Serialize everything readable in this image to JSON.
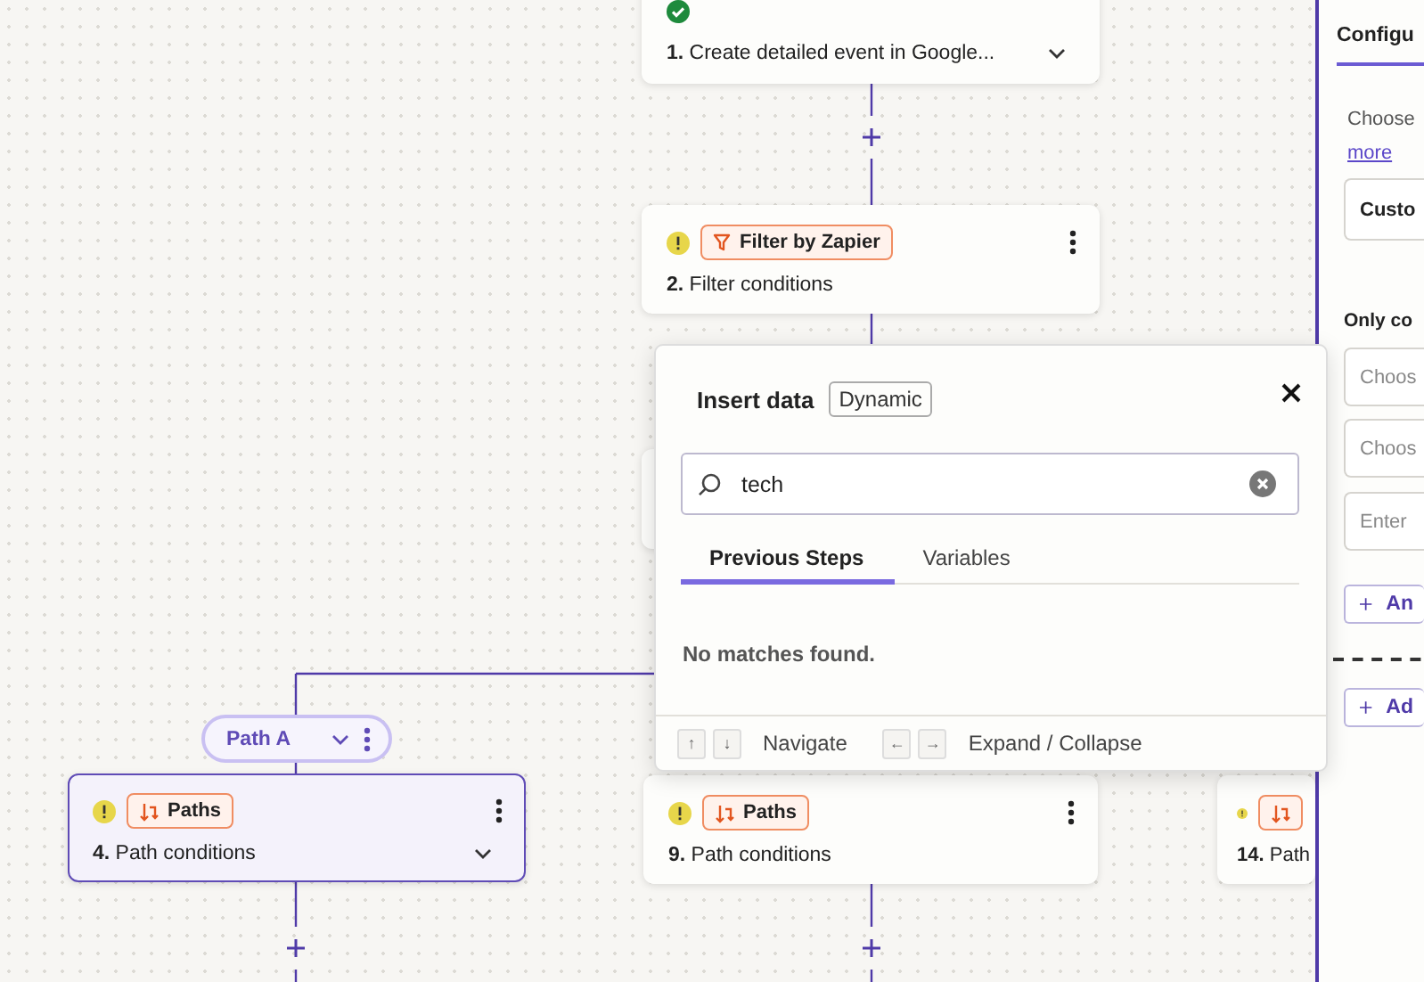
{
  "steps": [
    {
      "number": "1.",
      "title": "Create detailed event in Google...",
      "kind": "done",
      "selected": false,
      "expandable": true,
      "menu": false
    },
    {
      "number": "2.",
      "title": "Filter conditions",
      "kind": "warning",
      "badge": {
        "kind": "filter",
        "label": "Filter by Zapier"
      },
      "selected": false,
      "expandable": false,
      "menu": true
    },
    {
      "number": "4.",
      "title": "Path conditions",
      "kind": "warning",
      "badge": {
        "kind": "paths",
        "label": "Paths"
      },
      "selected": true,
      "expandable": true,
      "menu": true
    },
    {
      "number": "9.",
      "title": "Path conditions",
      "kind": "warning",
      "badge": {
        "kind": "paths",
        "label": "Paths"
      },
      "selected": false,
      "expandable": false,
      "menu": true
    },
    {
      "number": "14.",
      "title": "Path",
      "kind": "warning",
      "badge": {
        "kind": "paths"
      },
      "selected": false,
      "expandable": false,
      "menu": false
    }
  ],
  "path_pill": {
    "label": "Path A"
  },
  "insert_data": {
    "title": "Insert data",
    "tag": "Dynamic",
    "search": {
      "value": "tech"
    },
    "tabs": [
      {
        "label": "Previous Steps",
        "selected": true
      },
      {
        "label": "Variables",
        "selected": false
      }
    ],
    "empty_message": "No matches found.",
    "shortcuts": [
      {
        "keys": [
          "↑",
          "↓"
        ],
        "label": "Navigate"
      },
      {
        "keys": [
          "←",
          "→"
        ],
        "label": "Expand / Collapse"
      }
    ]
  },
  "side_panel": {
    "tab": "Configu",
    "intro": "Choose",
    "link": "more",
    "select_value": "Custo",
    "section_title": "Only co",
    "fields": [
      {
        "placeholder": "Choos"
      },
      {
        "placeholder": "Choos"
      },
      {
        "placeholder": "Enter"
      }
    ],
    "buttons": [
      "An",
      "Ad"
    ]
  }
}
